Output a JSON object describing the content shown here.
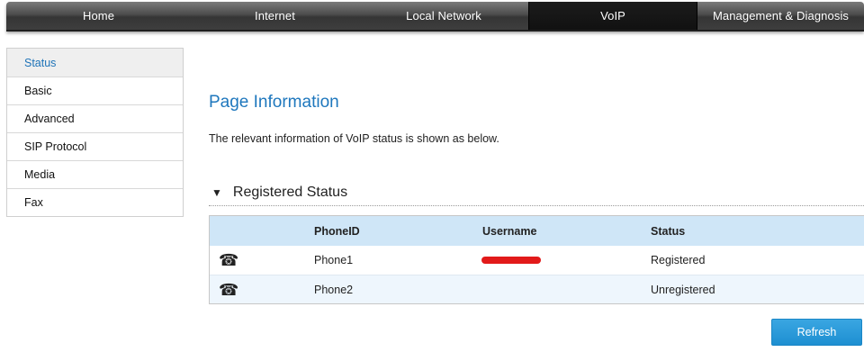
{
  "topnav": {
    "items": [
      {
        "label": "Home"
      },
      {
        "label": "Internet"
      },
      {
        "label": "Local Network"
      },
      {
        "label": "VoIP",
        "active": true
      },
      {
        "label": "Management & Diagnosis"
      }
    ]
  },
  "sidebar": {
    "items": [
      {
        "label": "Status",
        "active": true
      },
      {
        "label": "Basic"
      },
      {
        "label": "Advanced"
      },
      {
        "label": "SIP Protocol"
      },
      {
        "label": "Media"
      },
      {
        "label": "Fax"
      }
    ]
  },
  "main": {
    "title": "Page Information",
    "description": "The relevant information of VoIP status is shown as below.",
    "section": {
      "title": "Registered Status",
      "columns": [
        "PhoneID",
        "Username",
        "Status"
      ],
      "rows": [
        {
          "icon": "phone-icon",
          "phone_id": "Phone1",
          "username": "",
          "username_redacted": true,
          "status": "Registered"
        },
        {
          "icon": "phone-icon",
          "phone_id": "Phone2",
          "username": "",
          "status": "Unregistered"
        }
      ]
    },
    "refresh_label": "Refresh"
  },
  "colors": {
    "accent": "#1e77bd",
    "header_row": "#cfe6f7",
    "alt_row": "#eef6fd",
    "button": "#2a9ad8",
    "redaction": "#e21a1a"
  }
}
